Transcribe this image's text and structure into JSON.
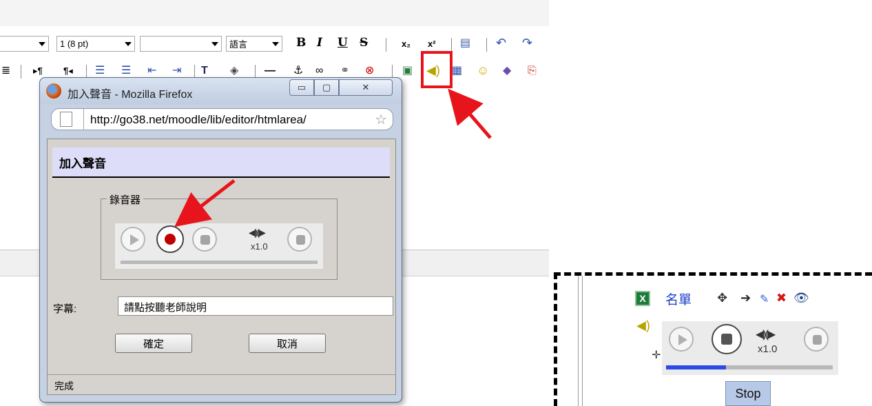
{
  "toolbar": {
    "font_size_value": "1 (8 pt)",
    "language_label": "語言",
    "bold_label": "B",
    "italic_label": "I",
    "underline_label": "U",
    "strike_label": "S",
    "subscript_label": "x₂",
    "superscript_label": "x²"
  },
  "popup": {
    "window_title": "加入聲音 - Mozilla Firefox",
    "url": "http://go38.net/moodle/lib/editor/htmlarea/",
    "dialog_title": "加入聲音",
    "recorder_legend": "錄音器",
    "speed_label": "x1.0",
    "caption_label": "字幕:",
    "caption_value": "請點按聽老師說明",
    "ok_label": "確定",
    "cancel_label": "取消",
    "status_text": "完成"
  },
  "inset": {
    "roster_label": "名單",
    "speed_label": "x1.0",
    "stop_label": "Stop",
    "progress_fraction": 0.36
  },
  "colors": {
    "highlight": "#e8141b",
    "dialog_title_bg": "#ddddfa",
    "link": "#1a3fc8",
    "progress": "#2b4be8"
  }
}
